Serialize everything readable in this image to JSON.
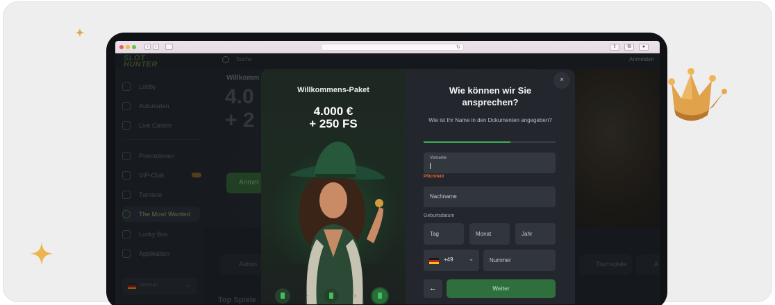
{
  "browser": {
    "controls": [
      "‹",
      "›"
    ],
    "right_icons": [
      "share-icon",
      "tabs-icon",
      "download-icon"
    ]
  },
  "site": {
    "logo_line1": "SLOT",
    "logo_line2": "HUNTER",
    "search_placeholder": "Suche",
    "login_label": "Anmelden",
    "sidebar": {
      "items": [
        {
          "label": "Lobby",
          "icon": "home-icon"
        },
        {
          "label": "Automaten",
          "icon": "slots-icon"
        },
        {
          "label": "Live Casino",
          "icon": "live-icon"
        },
        {
          "label": "Promotionen",
          "icon": "gift-icon"
        },
        {
          "label": "VIP-Club",
          "icon": "crown-icon"
        },
        {
          "label": "Turniere",
          "icon": "trophy-icon"
        },
        {
          "label": "The Most Wanted",
          "icon": "avatar-icon"
        },
        {
          "label": "Lucky Box",
          "icon": "box-icon"
        },
        {
          "label": "Applikation",
          "icon": "app-icon"
        }
      ],
      "language": "German"
    },
    "hero": {
      "title": "Willkomm",
      "big_line1": "4.0",
      "big_line2": "+ 2",
      "button": "Anmel"
    },
    "categories": [
      "Autom",
      "Tischspiele",
      "A"
    ],
    "section_title": "Top Spiele"
  },
  "modal": {
    "promo": {
      "title": "Willkommens-Paket",
      "amount_line1": "4.000 €",
      "amount_line2": "+ 250 FS",
      "steps": [
        "step-1",
        "step-2",
        "step-3"
      ],
      "active_step": 3
    },
    "close_label": "×",
    "title": "Wie können wir Sie ansprechen?",
    "subtitle": "Wie ist Ihr Name in den Dokumenten angegeben?",
    "progress": 0.66,
    "first_name_label": "Vorname",
    "required_text": "Pflichtfeld",
    "last_name_placeholder": "Nachname",
    "birthdate_label": "Geburtsdatum",
    "day_placeholder": "Tag",
    "month_placeholder": "Monat",
    "year_placeholder": "Jahr",
    "phone_code": "+49",
    "phone_placeholder": "Nummer",
    "back_label": "←",
    "next_label": "Weiter"
  },
  "colors": {
    "accent_green": "#3fae5b",
    "button_green": "#2f6e3d",
    "error_orange": "#e06b36"
  }
}
